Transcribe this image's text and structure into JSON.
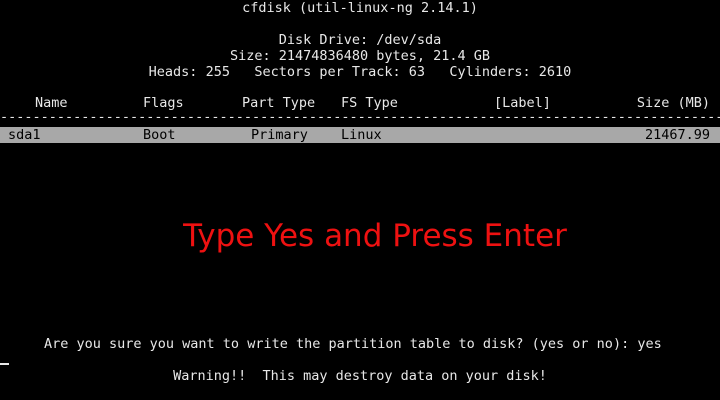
{
  "title": "cfdisk (util-linux-ng 2.14.1)",
  "disk": {
    "drive": "Disk Drive: /dev/sda",
    "size": "Size: 21474836480 bytes, 21.4 GB",
    "geometry": "Heads: 255   Sectors per Track: 63   Cylinders: 2610"
  },
  "table": {
    "headers": {
      "name": "Name",
      "flags": "Flags",
      "part_type": "Part Type",
      "fs_type": "FS Type",
      "label": "[Label]",
      "size": "Size (MB)"
    },
    "divider": "--------------------------------------------------------------------------------------------------------",
    "rows": [
      {
        "name": "sda1",
        "flags": "Boot",
        "part_type": "Primary",
        "fs_type": "Linux",
        "label": "",
        "size": "21467.99"
      }
    ]
  },
  "annotation": "Type Yes and Press Enter",
  "prompt": "Are you sure you want to write the partition table to disk? (yes or no): yes",
  "warning": "Warning!!  This may destroy data on your disk!",
  "colors": {
    "background": "#000000",
    "text": "#e8e8e8",
    "highlight_bg": "#a8a8a8",
    "annotation": "#ee1111"
  }
}
